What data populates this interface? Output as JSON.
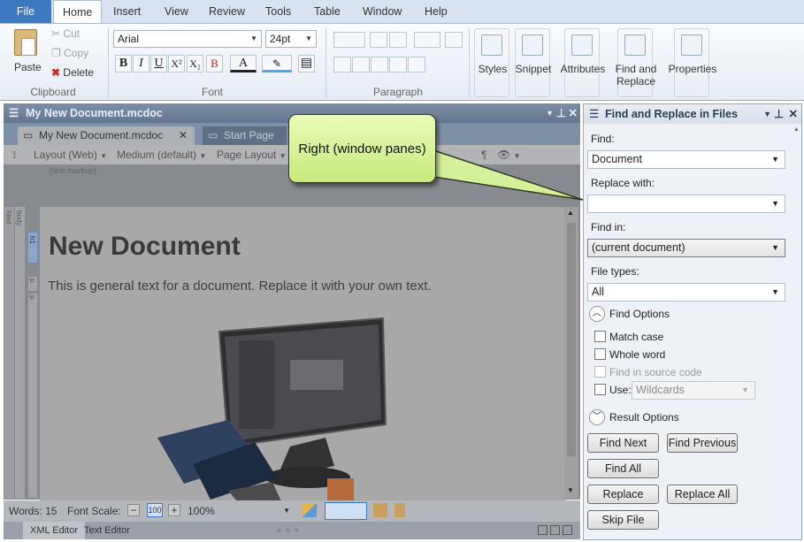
{
  "menubar": {
    "file": "File",
    "items": [
      "Home",
      "Insert",
      "View",
      "Review",
      "Tools",
      "Table",
      "Window",
      "Help"
    ]
  },
  "ribbon": {
    "clipboard": {
      "paste": "Paste",
      "cut": "Cut",
      "copy": "Copy",
      "delete": "Delete",
      "label": "Clipboard"
    },
    "font": {
      "family": "Arial",
      "size": "24pt",
      "label": "Font"
    },
    "paragraph": {
      "label": "Paragraph"
    },
    "large_buttons": [
      "Styles",
      "Snippet",
      "Attributes",
      "Find and Replace",
      "Properties"
    ]
  },
  "editor": {
    "title": "My New Document.mcdoc",
    "tabs": [
      "My New Document.mcdoc",
      "Start Page"
    ],
    "toolbar": {
      "layout": "Layout (Web)",
      "medium": "Medium (default)",
      "page_layout": "Page Layout"
    },
    "text_markup": "(text markup)",
    "structure_labels": [
      "html",
      "body",
      "h1",
      "p",
      "p"
    ],
    "document": {
      "heading": "New Document",
      "paragraph": "This is general text for a document. Replace it with your own text."
    }
  },
  "statusbar": {
    "words": "Words: 15",
    "font_scale": "Font Scale:",
    "zoom": "100%"
  },
  "bottom_tabs": [
    "XML Editor",
    "Text Editor"
  ],
  "panel": {
    "title": "Find and Replace in Files",
    "find_label": "Find:",
    "find_value": "Document",
    "replace_label": "Replace with:",
    "replace_value": "",
    "find_in_label": "Find in:",
    "find_in_value": "(current document)",
    "file_types_label": "File types:",
    "file_types_value": "All",
    "find_options": "Find Options",
    "match_case": "Match case",
    "whole_word": "Whole word",
    "find_in_source": "Find in source code",
    "use": "Use:",
    "use_value": "Wildcards",
    "result_options": "Result Options",
    "buttons": {
      "find_next": "Find Next",
      "find_previous": "Find Previous",
      "find_all": "Find All",
      "replace": "Replace",
      "replace_all": "Replace All",
      "skip_file": "Skip File"
    }
  },
  "callout": "Right (window panes)",
  "colors": {
    "accent": "#3c79c0",
    "callout": "#d5f09a"
  }
}
